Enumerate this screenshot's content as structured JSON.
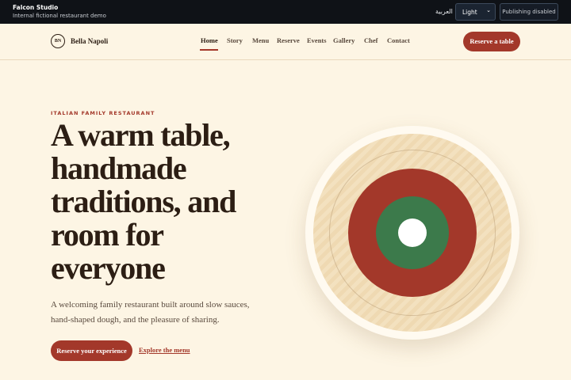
{
  "topbar": {
    "app_name": "Falcon Studio",
    "app_subtitle": "Internal fictional restaurant demo",
    "language_link": "العربية",
    "theme_select": {
      "value": "Light"
    },
    "publish_button": "Publishing disabled"
  },
  "header": {
    "logo_mark": "BN",
    "brand_name": "Bella Napoli",
    "nav": [
      {
        "label": "Home",
        "active": true
      },
      {
        "label": "Story"
      },
      {
        "label": "Menu"
      },
      {
        "label": "Reserve"
      },
      {
        "label": "Events"
      },
      {
        "label": "Gallery"
      },
      {
        "label": "Chef"
      },
      {
        "label": "Contact"
      }
    ],
    "reserve_button": "Reserve a table"
  },
  "hero": {
    "eyebrow": "ITALIAN FAMILY RESTAURANT",
    "title": "A warm table, handmade traditions, and room for everyone",
    "description": "A welcoming family restaurant built around slow sauces, hand-shaped dough, and the pleasure of sharing.",
    "primary_cta": "Reserve your experience",
    "secondary_cta": "Explore the menu"
  },
  "colors": {
    "accent": "#a3382a",
    "green": "#3c7a4b",
    "background": "#fdf5e4",
    "ink": "#2c1e14"
  }
}
